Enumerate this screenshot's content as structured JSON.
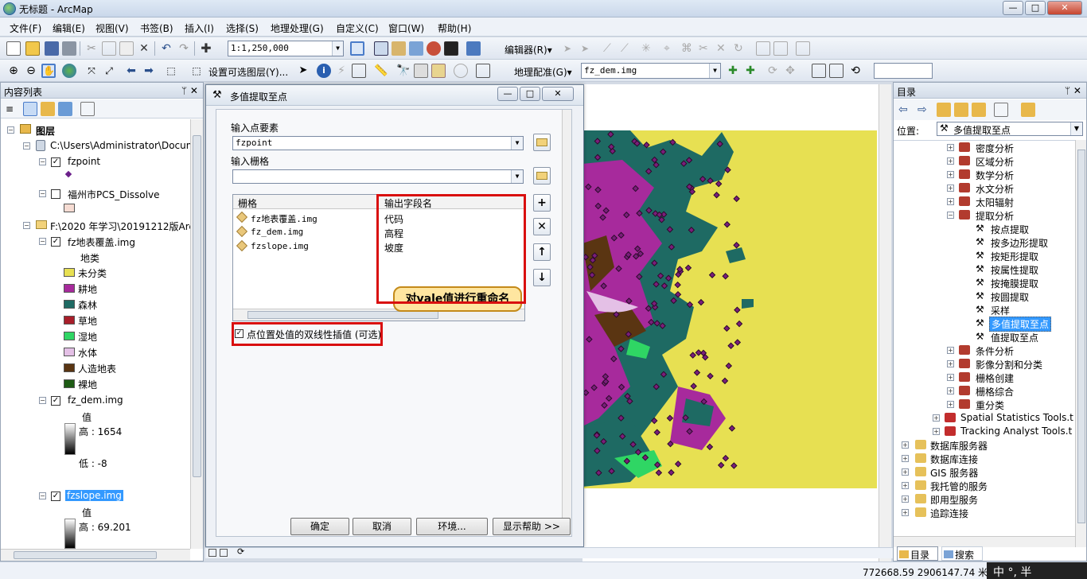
{
  "window": {
    "title": "无标题 - ArcMap",
    "min": "—",
    "max": "□",
    "close": "✕"
  },
  "menu": [
    "文件(F)",
    "编辑(E)",
    "视图(V)",
    "书签(B)",
    "插入(I)",
    "选择(S)",
    "地理处理(G)",
    "自定义(C)",
    "窗口(W)",
    "帮助(H)"
  ],
  "toolbar1": {
    "scale": "1:1,250,000",
    "editor": "编辑器(R)▾"
  },
  "toolbar2": {
    "select_layers": "设置可选图层(Y)...",
    "georef": "地理配准(G)▾",
    "georef_layer": "fz_dem.img"
  },
  "toc": {
    "title": "内容列表",
    "pin": "ᛘ ✕",
    "root": "图层",
    "folder1": "C:\\Users\\Administrator\\Docum",
    "fzpoint": "fzpoint",
    "dissolve": "福州市PCS_Dissolve",
    "folder2": "F:\\2020 年学习\\20191212版Arc",
    "landcover": "fz地表覆盖.img",
    "landcover_field": "地类",
    "classes": [
      {
        "label": "未分类",
        "color": "#e7e052"
      },
      {
        "label": "耕地",
        "color": "#a72a9c"
      },
      {
        "label": "森林",
        "color": "#1e6a63"
      },
      {
        "label": "草地",
        "color": "#a81e2a"
      },
      {
        "label": "湿地",
        "color": "#2fd664"
      },
      {
        "label": "水体",
        "color": "#e4c0e6"
      },
      {
        "label": "人造地表",
        "color": "#5a3512"
      },
      {
        "label": "裸地",
        "color": "#1d5b14"
      }
    ],
    "dem": "fz_dem.img",
    "dem_value": "值",
    "dem_high": "高 : 1654",
    "dem_low": "低 : -8",
    "slope": "fzslope.img",
    "slope_value": "值",
    "slope_high": "高 : 69.201"
  },
  "dialog": {
    "title": "多值提取至点",
    "in_points_label": "输入点要素",
    "in_points_value": "fzpoint",
    "in_raster_label": "输入栅格",
    "in_raster_value": "",
    "col_raster": "栅格",
    "col_field": "输出字段名",
    "rows": [
      {
        "raster": "fz地表覆盖.img",
        "field": "代码"
      },
      {
        "raster": "fz_dem.img",
        "field": "高程"
      },
      {
        "raster": "fzslope.img",
        "field": "坡度"
      }
    ],
    "callout": "对vale值进行重命名",
    "bilinear": "点位置处值的双线性插值 (可选)",
    "ok": "确定",
    "cancel": "取消",
    "env": "环境...",
    "help": "显示帮助 >>",
    "side_buttons": [
      "+",
      "✕",
      "↑",
      "↓"
    ]
  },
  "catalog": {
    "title": "目录",
    "location_label": "位置:",
    "location_value": "多值提取至点",
    "items": [
      "密度分析",
      "区域分析",
      "数学分析",
      "水文分析",
      "太阳辐射",
      "提取分析",
      "按点提取",
      "按多边形提取",
      "按矩形提取",
      "按属性提取",
      "按掩膜提取",
      "按圆提取",
      "采样",
      "多值提取至点",
      "值提取至点",
      "条件分析",
      "影像分割和分类",
      "栅格创建",
      "栅格综合",
      "重分类",
      "Spatial Statistics Tools.t",
      "Tracking Analyst Tools.t",
      "数据库服务器",
      "数据库连接",
      "GIS 服务器",
      "我托管的服务",
      "即用型服务",
      "追踪连接"
    ],
    "tab_catalog": "目录",
    "tab_search": "搜索"
  },
  "status": {
    "coords": "772668.59  2906147.74 米",
    "ime": "中 °, 半"
  }
}
